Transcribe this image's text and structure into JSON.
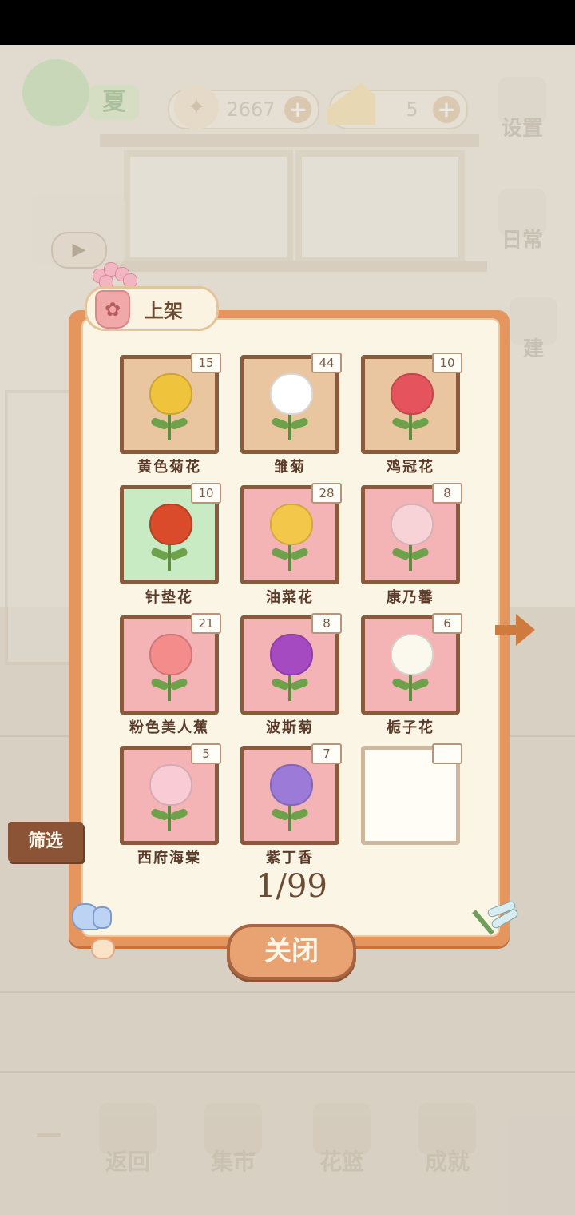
{
  "hud": {
    "season": "夏",
    "coins": "2667",
    "cheese": "5",
    "plus": "+"
  },
  "side_menu": [
    {
      "label": "设置",
      "icon": "gear-icon"
    },
    {
      "label": "日常",
      "icon": "notepad-icon"
    },
    {
      "label": "建",
      "icon": "hammer-icon"
    }
  ],
  "panel": {
    "title": "上架",
    "title_icon": "✿",
    "page": "1/99",
    "filter_label": "筛选",
    "close_label": "关闭"
  },
  "flowers": [
    {
      "name": "黄色菊花",
      "count": "15",
      "bg": "tan",
      "color": "#f0c33d"
    },
    {
      "name": "雏菊",
      "count": "44",
      "bg": "tan",
      "color": "#ffffff"
    },
    {
      "name": "鸡冠花",
      "count": "10",
      "bg": "tan",
      "color": "#e5535c"
    },
    {
      "name": "针垫花",
      "count": "10",
      "bg": "mint",
      "color": "#d94b2a"
    },
    {
      "name": "油菜花",
      "count": "28",
      "bg": "pink",
      "color": "#f3c84a"
    },
    {
      "name": "康乃馨",
      "count": "8",
      "bg": "pink",
      "color": "#f7d3d8"
    },
    {
      "name": "粉色美人蕉",
      "count": "21",
      "bg": "pink",
      "color": "#f58c8c"
    },
    {
      "name": "波斯菊",
      "count": "8",
      "bg": "pink",
      "color": "#a64ac2"
    },
    {
      "name": "栀子花",
      "count": "6",
      "bg": "pink",
      "color": "#fbf9ee"
    },
    {
      "name": "西府海棠",
      "count": "5",
      "bg": "pink",
      "color": "#f9cbd5"
    },
    {
      "name": "紫丁香",
      "count": "7",
      "bg": "pink",
      "color": "#9b7ad8"
    },
    {
      "name": "",
      "count": "",
      "bg": "empty",
      "color": ""
    }
  ],
  "bottom_nav": [
    {
      "label": "返回",
      "icon": "window-icon"
    },
    {
      "label": "集市",
      "icon": "market-stall-icon"
    },
    {
      "label": "花篮",
      "icon": "flower-basket-icon"
    },
    {
      "label": "成就",
      "icon": "trophy-icon"
    }
  ]
}
